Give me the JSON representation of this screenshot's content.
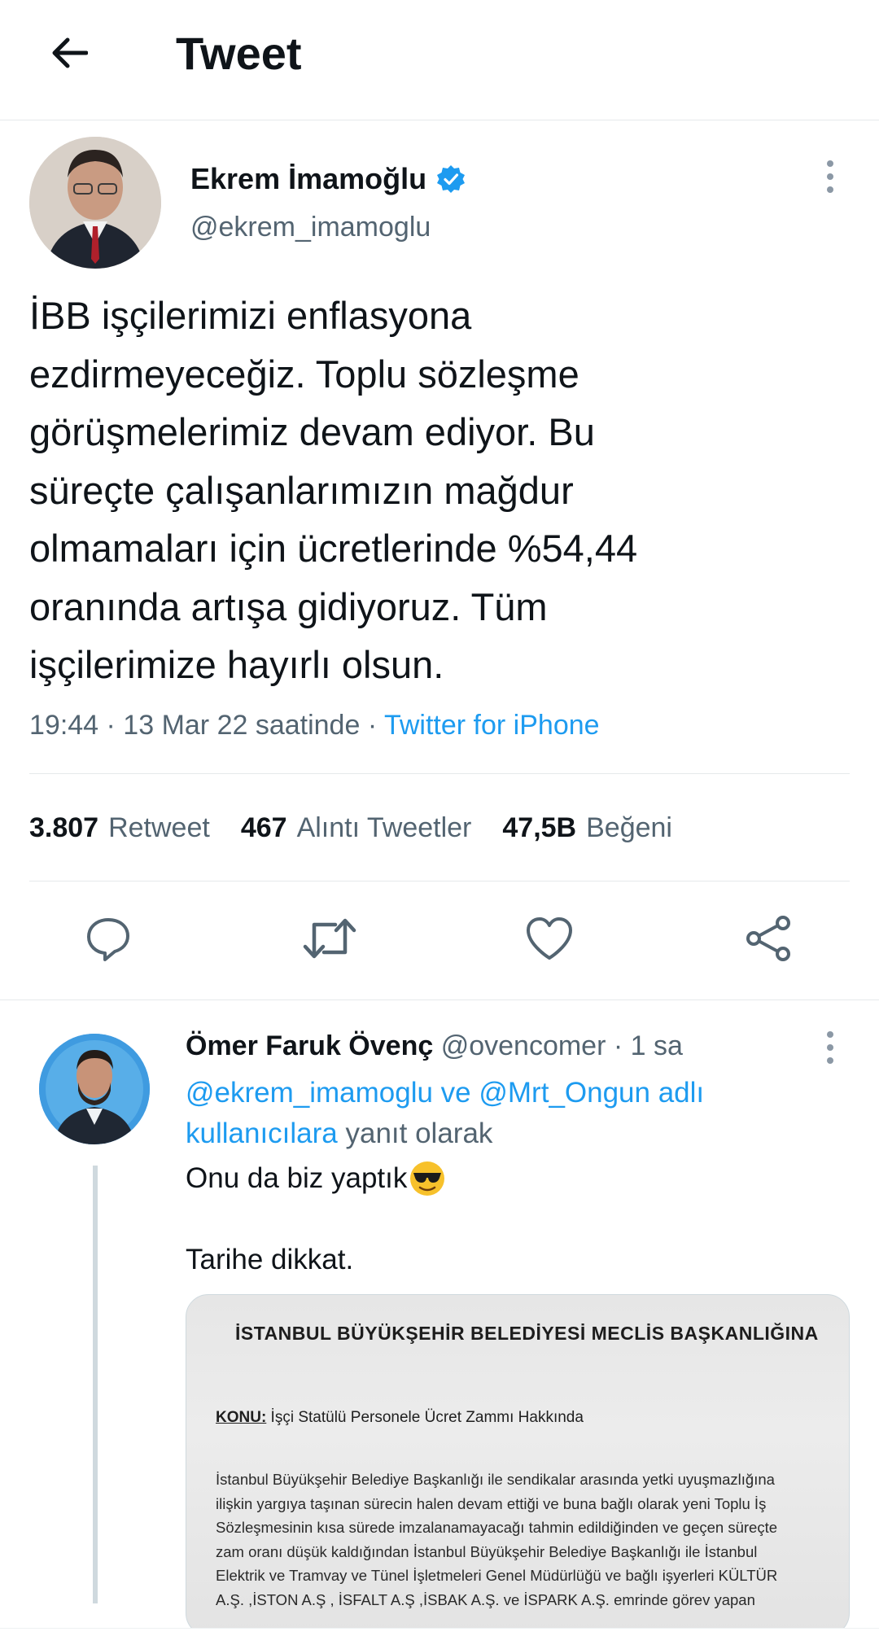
{
  "header": {
    "title": "Tweet",
    "back_icon": "arrow-left-icon"
  },
  "tweet": {
    "author_name": "Ekrem İmamoğlu",
    "author_handle": "@ekrem_imamoglu",
    "verified_color": "#1d9bf0",
    "text": "İBB işçilerimizi enflasyona\nezdirmeyeceğiz. Toplu sözleşme\ngörüşmelerimiz devam ediyor. Bu\nsüreçte çalışanlarımızın mağdur\nolmamaları için ücretlerinde %54,44\noranında artışa gidiyoruz. Tüm\nişçilerimize hayırlı olsun.",
    "time": "19:44 · 13 Mar 22 saatinde · ",
    "source": "Twitter for iPhone",
    "stats": {
      "retweets_count": "3.807",
      "retweets_label": "Retweet",
      "quotes_count": "467",
      "quotes_label": "Alıntı Tweetler",
      "likes_count": "47,5B",
      "likes_label": "Beğeni"
    },
    "actions": [
      "reply-icon",
      "retweet-icon",
      "like-icon",
      "share-icon"
    ]
  },
  "reply": {
    "author_name": "Ömer Faruk Övenç",
    "author_handle": "@ovencomer",
    "time": "· 1 sa",
    "reply_to_link": "@ekrem_imamoglu ve @Mrt_Ongun adlı kullanıcılara",
    "reply_to_suffix": " yanıt olarak",
    "text_line1": "Onu da biz yaptık",
    "emoji": "smiling-face-with-sunglasses",
    "text_line2": "Tarihe dikkat.",
    "document": {
      "heading": "İSTANBUL BÜYÜKŞEHİR BELEDİYESİ MECLİS BAŞKANLIĞINA",
      "subject_label": "KONU:",
      "subject_text": " İşçi Statülü Personele Ücret Zammı Hakkında",
      "lines": [
        "İstanbul Büyükşehir Belediye Başkanlığı ile sendikalar arasında yetki uyuşmazlığına",
        "ilişkin yargıya taşınan sürecin halen devam ettiği ve buna bağlı olarak yeni Toplu İş",
        "Sözleşmesinin kısa sürede imzalanamayacağı tahmin edildiğinden ve geçen süreçte",
        "zam oranı düşük kaldığından İstanbul Büyükşehir Belediye Başkanlığı ile İstanbul",
        "Elektrik ve Tramvay ve Tünel İşletmeleri Genel Müdürlüğü ve bağlı işyerleri KÜLTÜR",
        "A.Ş. ,İSTON A.Ş , İSFALT A.Ş ,İSBAK A.Ş. ve İSPARK A.Ş. emrinde görev yapan"
      ]
    }
  }
}
